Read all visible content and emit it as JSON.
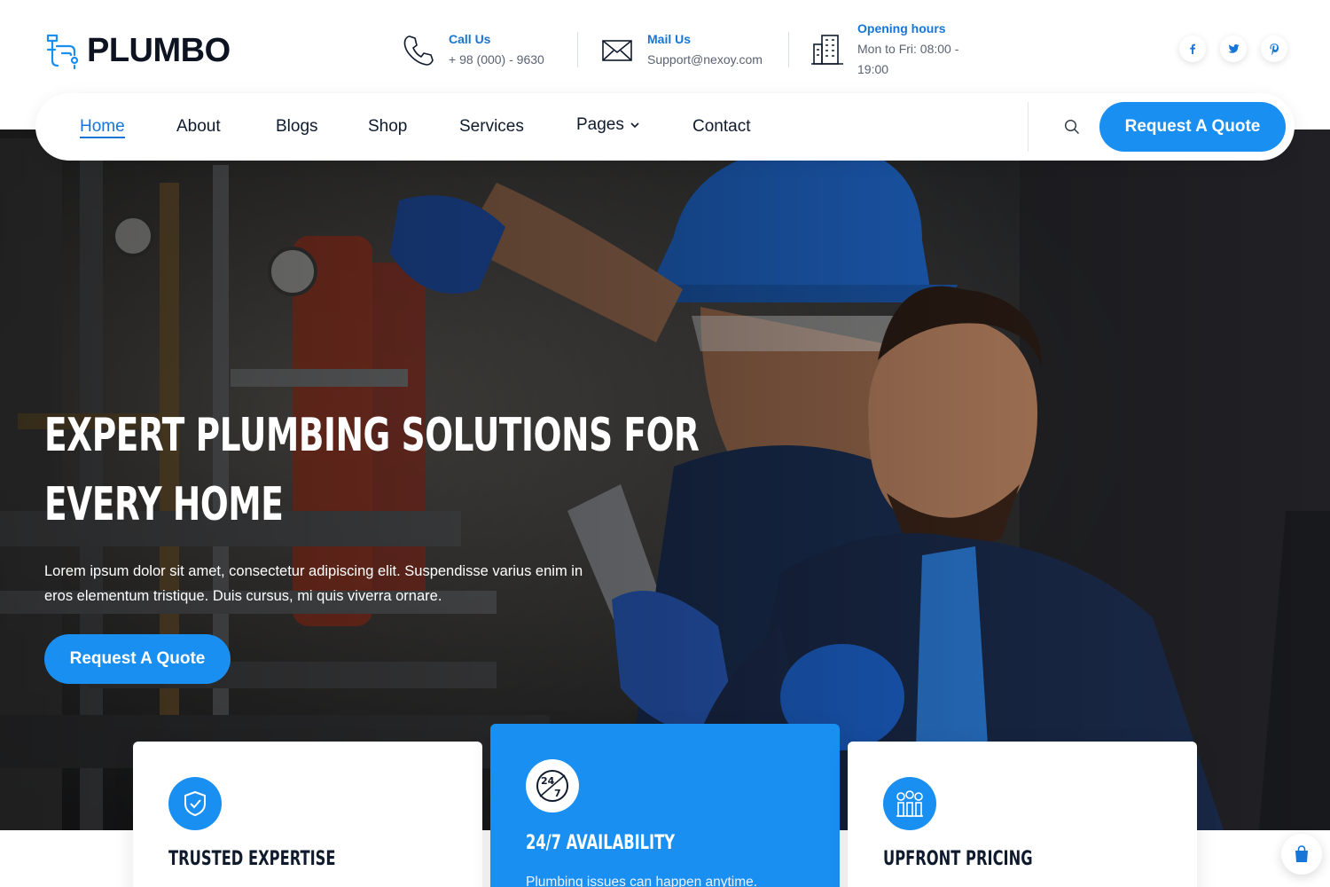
{
  "brand": {
    "name": "PLUMBO",
    "logo_icon": "faucet-wrench-icon"
  },
  "contact": {
    "call": {
      "label": "Call Us",
      "value": "+ 98 (000) - 9630",
      "icon": "phone-icon"
    },
    "mail": {
      "label": "Mail Us",
      "value": "Support@nexoy.com",
      "icon": "envelope-icon"
    },
    "hours": {
      "label": "Opening hours",
      "value": "Mon to Fri: 08:00 - 19:00",
      "icon": "building-icon"
    }
  },
  "social": [
    {
      "icon": "facebook-icon",
      "glyph": "f"
    },
    {
      "icon": "twitter-icon",
      "glyph": "t"
    },
    {
      "icon": "pinterest-icon",
      "glyph": "p"
    }
  ],
  "nav": {
    "items": [
      {
        "label": "Home",
        "active": true
      },
      {
        "label": "About"
      },
      {
        "label": "Blogs"
      },
      {
        "label": "Shop"
      },
      {
        "label": "Services"
      },
      {
        "label": "Pages",
        "dropdown": true
      },
      {
        "label": "Contact"
      }
    ],
    "quote_label": "Request A Quote"
  },
  "hero": {
    "headline_line1": "Expert Plumbing Solutions For",
    "headline_line2": "Every Home",
    "lead": "Lorem ipsum dolor sit amet, consectetur adipiscing elit. Suspendisse varius enim in eros elementum tristique. Duis cursus, mi quis viverra ornare.",
    "button_label": "Request A Quote"
  },
  "features": [
    {
      "title": "Trusted Expertise",
      "icon": "shield-check-icon",
      "text": ""
    },
    {
      "title": "24/7 Availability",
      "icon": "clock-24-7-icon",
      "text": "Plumbing issues can happen anytime."
    },
    {
      "title": "Upfront Pricing",
      "icon": "coins-chart-icon",
      "text": ""
    }
  ],
  "colors": {
    "accent": "#1a8ff2",
    "brand_blue": "#1675d6",
    "dark": "#0f1b2d"
  },
  "cart_icon": "shopping-bag-icon"
}
